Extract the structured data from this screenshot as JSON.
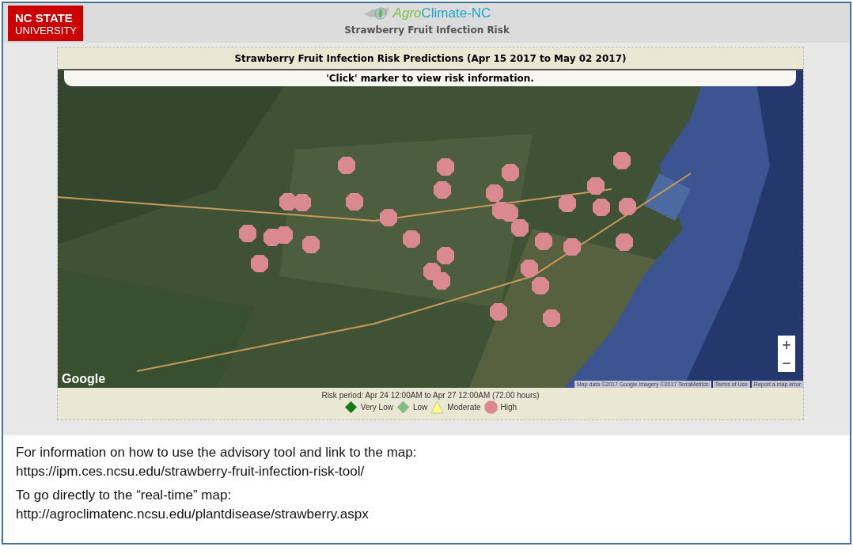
{
  "header": {
    "university_logo": [
      "NC STATE",
      "UNIVERSITY"
    ],
    "app_logo": {
      "part_1": "Agro",
      "part_2": "Climate-NC"
    },
    "subtitle": "Strawberry Fruit Infection Risk"
  },
  "panel": {
    "title": "Strawberry Fruit Infection Risk Predictions (Apr 15 2017 to May 02 2017)",
    "hint": "'Click' marker to view risk information.",
    "map": {
      "kind": "picture",
      "logo": "Google",
      "zoom_buttons": [
        "+",
        "−"
      ],
      "attribution": [
        "Map data ©2017 Google Imagery ©2017 TerraMetrics",
        "Terms of Use",
        "Report a map error"
      ],
      "markers": [
        {
          "color": "#d9898f"
        },
        {
          "color": "#d9898f"
        },
        {
          "color": "#d9898f"
        },
        {
          "color": "#d9898f"
        },
        {
          "color": "#d9898f"
        },
        {
          "color": "#d9898f"
        },
        {
          "color": "#d9898f"
        },
        {
          "color": "#d9898f"
        },
        {
          "color": "#d9898f"
        },
        {
          "color": "#d9898f"
        },
        {
          "color": "#d9898f"
        },
        {
          "color": "#d9898f"
        },
        {
          "color": "#d9898f"
        },
        {
          "color": "#d9898f"
        },
        {
          "color": "#d9898f"
        },
        {
          "color": "#d9898f"
        },
        {
          "color": "#d9898f"
        },
        {
          "color": "#d9898f"
        },
        {
          "color": "#d9898f"
        },
        {
          "color": "#d9898f"
        },
        {
          "color": "#d9898f"
        },
        {
          "color": "#d9898f"
        },
        {
          "color": "#d9898f"
        },
        {
          "color": "#d9898f"
        },
        {
          "color": "#d9898f"
        },
        {
          "color": "#d9898f"
        },
        {
          "color": "#d9898f"
        },
        {
          "color": "#d9898f"
        },
        {
          "color": "#d9898f"
        },
        {
          "color": "#d9898f"
        },
        {
          "color": "#d9898f"
        },
        {
          "color": "#d9898f"
        },
        {
          "color": "#d9898f"
        }
      ]
    },
    "risk_period": "Risk period: Apr 24 12:00AM to Apr 27 12:00AM (72.00 hours)",
    "legend": [
      {
        "kind": "diamond",
        "color": "#107c10",
        "label": "Very Low"
      },
      {
        "kind": "diamond",
        "color": "#7fbf7f",
        "label": "Low"
      },
      {
        "kind": "triangle",
        "color": "#ffff88",
        "label": "Moderate"
      },
      {
        "kind": "octagon",
        "color": "#d9898f",
        "label": "High"
      }
    ]
  },
  "notes": [
    {
      "text": "For information on how to use the advisory tool and link to the map:",
      "link": "https://ipm.ces.ncsu.edu/strawberry-fruit-infection-risk-tool/"
    },
    {
      "text": "To go directly to the “real-time” map:",
      "link": "http://agroclimatenc.ncsu.edu/plantdisease/strawberry.aspx"
    }
  ]
}
